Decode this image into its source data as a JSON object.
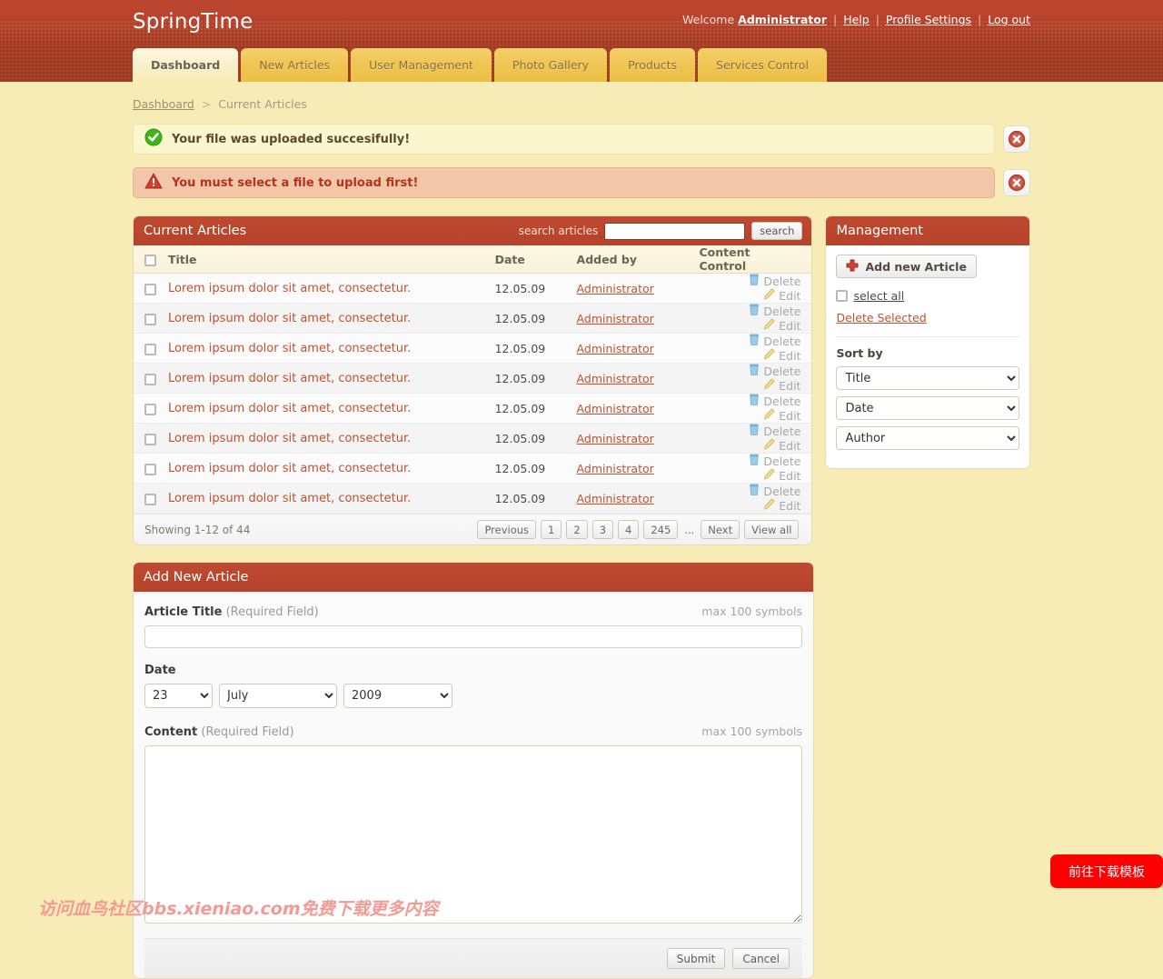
{
  "header": {
    "brand": "SpringTime",
    "welcome_prefix": "Welcome",
    "user": "Administrator",
    "help": "Help",
    "profile_settings": "Profile Settings",
    "log_out": "Log out",
    "separator": "|"
  },
  "tabs": [
    {
      "label": "Dashboard",
      "active": true
    },
    {
      "label": "New Articles",
      "active": false
    },
    {
      "label": "User Management",
      "active": false
    },
    {
      "label": "Photo Gallery",
      "active": false
    },
    {
      "label": "Products",
      "active": false
    },
    {
      "label": "Services Control",
      "active": false
    }
  ],
  "breadcrumb": {
    "root": "Dashboard",
    "separator": ">",
    "current": "Current Articles"
  },
  "alerts": [
    {
      "type": "success",
      "icon": "check-circle-icon",
      "message": "Your file was uploaded succesifully!"
    },
    {
      "type": "error",
      "icon": "warning-triangle-icon",
      "message": "You must select a file to upload first!"
    }
  ],
  "articles_panel": {
    "title": "Current Articles",
    "search_label": "search articles",
    "search_value": "",
    "search_placeholder": "",
    "search_button": "search",
    "columns": [
      "Title",
      "Date",
      "Added by",
      "Content Control"
    ],
    "delete_label": "Delete",
    "edit_label": "Edit",
    "rows": [
      {
        "title": "Lorem ipsum dolor sit amet, consectetur.",
        "date": "12.05.09",
        "added_by": "Administrator"
      },
      {
        "title": "Lorem ipsum dolor sit amet, consectetur.",
        "date": "12.05.09",
        "added_by": "Administrator"
      },
      {
        "title": "Lorem ipsum dolor sit amet, consectetur.",
        "date": "12.05.09",
        "added_by": "Administrator"
      },
      {
        "title": "Lorem ipsum dolor sit amet, consectetur.",
        "date": "12.05.09",
        "added_by": "Administrator"
      },
      {
        "title": "Lorem ipsum dolor sit amet, consectetur.",
        "date": "12.05.09",
        "added_by": "Administrator"
      },
      {
        "title": "Lorem ipsum dolor sit amet, consectetur.",
        "date": "12.05.09",
        "added_by": "Administrator"
      },
      {
        "title": "Lorem ipsum dolor sit amet, consectetur.",
        "date": "12.05.09",
        "added_by": "Administrator"
      },
      {
        "title": "Lorem ipsum dolor sit amet, consectetur.",
        "date": "12.05.09",
        "added_by": "Administrator"
      }
    ],
    "showing": "Showing 1-12 of 44",
    "pager": [
      "Previous",
      "1",
      "2",
      "3",
      "4",
      "245",
      "...",
      "Next",
      "View all"
    ]
  },
  "management": {
    "title": "Management",
    "add_button": "Add new Article",
    "select_all": "select all",
    "delete_selected": "Delete Selected",
    "sort_by_label": "Sort by",
    "sort_selects": [
      {
        "value": "Title"
      },
      {
        "value": "Date"
      },
      {
        "value": "Author"
      }
    ]
  },
  "form": {
    "title": "Add New Article",
    "article_title_label": "Article Title",
    "article_title_required": "(Required Field)",
    "article_title_hint": "max 100 symbols",
    "article_title_value": "",
    "date_label": "Date",
    "date_day": "23",
    "date_month": "July",
    "date_year": "2009",
    "content_label": "Content",
    "content_required": "(Required Field)",
    "content_hint": "max 100 symbols",
    "content_value": "",
    "buttons": [
      "Submit",
      "Cancel"
    ]
  },
  "overlay": {
    "watermark": "访问血鸟社区bbs.xieniao.com免费下载更多内容",
    "download_button": "前往下载模板",
    "download_button_color": "#fe0000"
  },
  "colors": {
    "brand_red": "#b5422a",
    "header_red": "#bd4630",
    "tab_yellow": "#efc553",
    "page_bg": "#f7ecb5",
    "link_red": "#c2502f"
  }
}
